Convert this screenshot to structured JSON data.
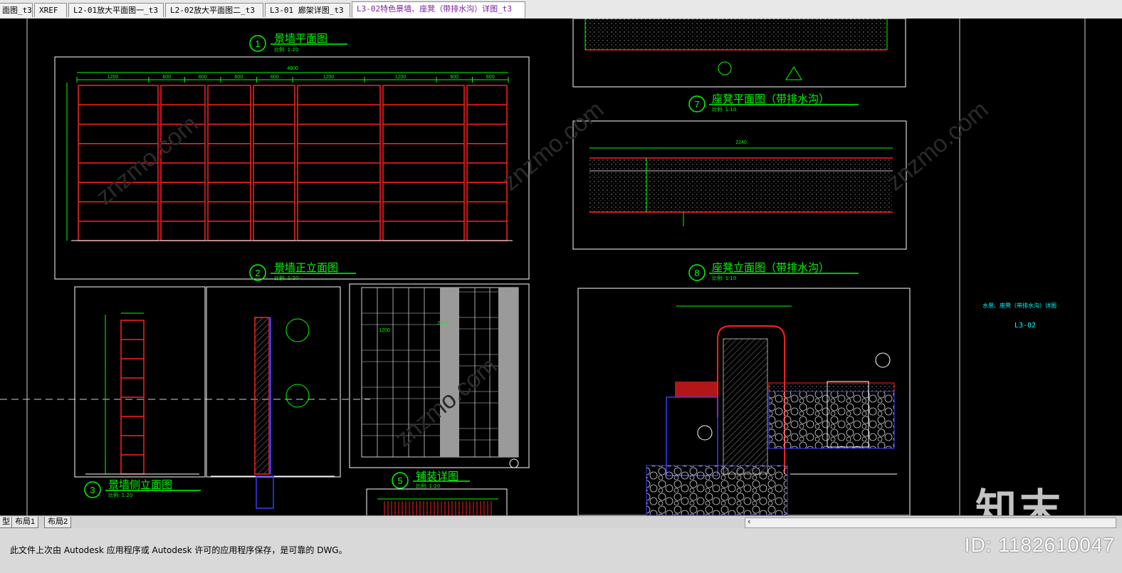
{
  "tabs": [
    {
      "label": "面图_t3",
      "active": false
    },
    {
      "label": "XREF",
      "active": false
    },
    {
      "label": "L2-01放大平面图一_t3",
      "active": false
    },
    {
      "label": "L2-02放大平面图二_t3",
      "active": false
    },
    {
      "label": "L3-01 廊架详图_t3",
      "active": false
    },
    {
      "label": "L3-02特色景墙、座凳（带排水沟）详图_t3",
      "active": true
    }
  ],
  "drawing": {
    "titles": [
      {
        "num": "1",
        "label": "景墙平面图",
        "scale": "比例: 1:20"
      },
      {
        "num": "2",
        "label": "景墙正立面图",
        "scale": "比例: 1:20"
      },
      {
        "num": "3",
        "label": "景墙侧立面图",
        "scale": "比例: 1:20"
      },
      {
        "num": "5",
        "label": "铺装详图",
        "scale": "比例: 1:20"
      },
      {
        "num": "7",
        "label": "座凳平面图（带排水沟）",
        "scale": "比例: 1:10"
      },
      {
        "num": "8",
        "label": "座凳立面图（带排水沟）",
        "scale": "比例: 1:10"
      }
    ],
    "front_dims": [
      "1200",
      "600",
      "600",
      "600",
      "600",
      "1200",
      "1200",
      "600",
      "600"
    ],
    "front_total": "4600",
    "bench_total": "2240",
    "paving_dims": [
      "1200",
      "2400"
    ],
    "title_block": {
      "name": "水景、座凳（带排水沟）详图",
      "code": "L3-02"
    },
    "colors": {
      "green": "#00ff00",
      "red": "#ff2020",
      "white": "#ffffff",
      "cyan": "#00ffff",
      "blue": "#3a3aff",
      "yellow": "#ffff00",
      "gray": "#9a9a9a"
    }
  },
  "layout_tabs": [
    "型",
    "布局1",
    "布局2"
  ],
  "status": {
    "message": "此文件上次由 Autodesk 应用程序或 Autodesk 许可的应用程序保存，是可靠的 DWG。",
    "id": "ID: 1182610047"
  },
  "watermark": {
    "logo": "知末",
    "site": "znzmo.com"
  }
}
